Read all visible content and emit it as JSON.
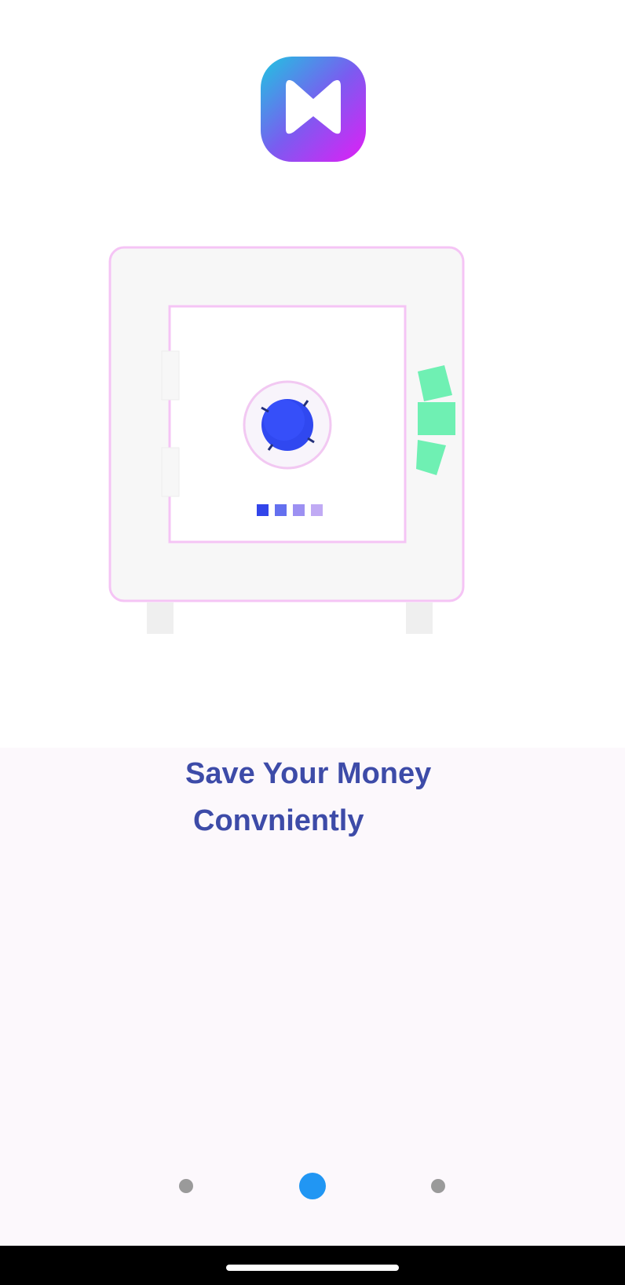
{
  "app": {
    "logo_icon": "m-logo-icon",
    "colors": {
      "logo_gradient_start": "#1ec6e0",
      "logo_gradient_mid": "#7a5cf0",
      "logo_gradient_end": "#e11ef5"
    }
  },
  "onboarding": {
    "illustration_icon": "safe-with-money-icon",
    "headline": {
      "line1": "Save Your Money",
      "line2": "Convniently"
    },
    "headline_color": "#3d4ba8",
    "page_indicator": {
      "total_pages": 3,
      "current_page": 2,
      "active_color": "#2196f3",
      "inactive_color": "#9a9a9a"
    }
  },
  "system_nav": {
    "home_indicator_icon": "home-indicator-bar"
  }
}
